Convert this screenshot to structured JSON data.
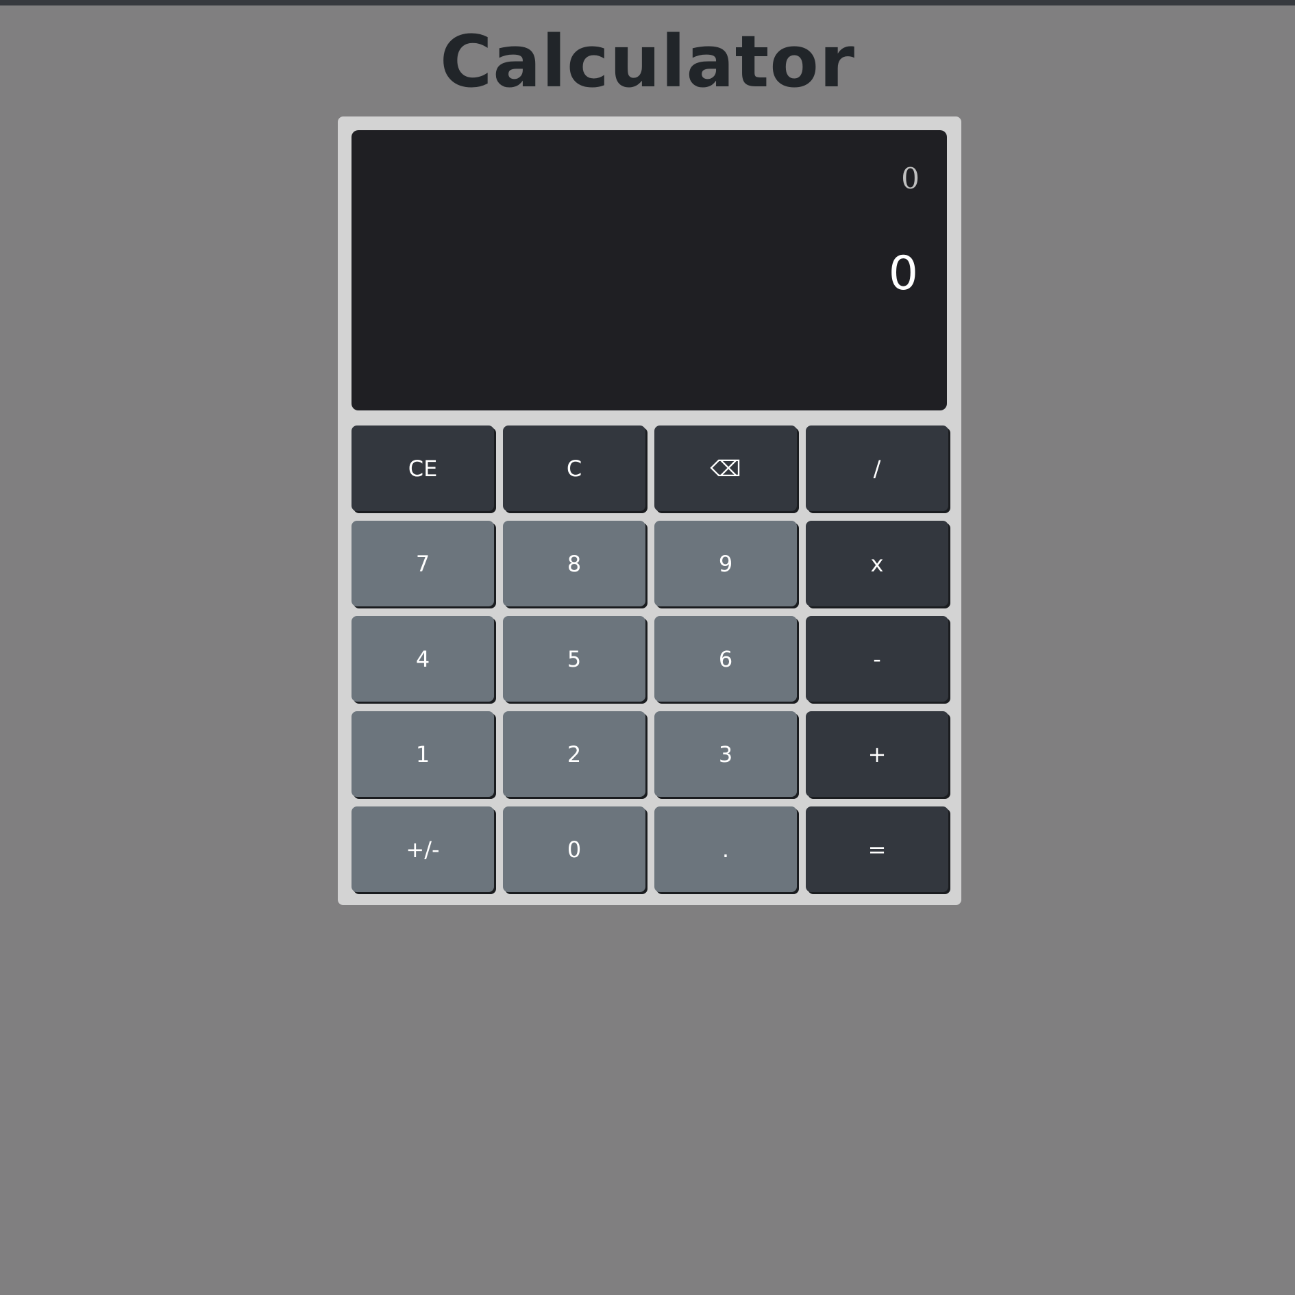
{
  "title": "Calculator",
  "display": {
    "previous": "0",
    "current": "0"
  },
  "keys": [
    {
      "label": "CE",
      "style": "dark",
      "name": "clear-entry-button"
    },
    {
      "label": "C",
      "style": "dark",
      "name": "clear-button"
    },
    {
      "label": "⌫",
      "style": "dark",
      "name": "backspace-button"
    },
    {
      "label": "/",
      "style": "dark",
      "name": "divide-button"
    },
    {
      "label": "7",
      "style": "light",
      "name": "digit-7-button"
    },
    {
      "label": "8",
      "style": "light",
      "name": "digit-8-button"
    },
    {
      "label": "9",
      "style": "light",
      "name": "digit-9-button"
    },
    {
      "label": "x",
      "style": "dark",
      "name": "multiply-button"
    },
    {
      "label": "4",
      "style": "light",
      "name": "digit-4-button"
    },
    {
      "label": "5",
      "style": "light",
      "name": "digit-5-button"
    },
    {
      "label": "6",
      "style": "light",
      "name": "digit-6-button"
    },
    {
      "label": "-",
      "style": "dark",
      "name": "subtract-button"
    },
    {
      "label": "1",
      "style": "light",
      "name": "digit-1-button"
    },
    {
      "label": "2",
      "style": "light",
      "name": "digit-2-button"
    },
    {
      "label": "3",
      "style": "light",
      "name": "digit-3-button"
    },
    {
      "label": "+",
      "style": "dark",
      "name": "add-button"
    },
    {
      "label": "+/-",
      "style": "light",
      "name": "negate-button"
    },
    {
      "label": "0",
      "style": "light",
      "name": "digit-0-button"
    },
    {
      "label": ".",
      "style": "light",
      "name": "decimal-button"
    },
    {
      "label": "=",
      "style": "dark",
      "name": "equals-button"
    }
  ],
  "colors": {
    "page_background": "#807f80",
    "frame": "#d3d3d3",
    "display_background": "#1f1f23",
    "operator_key": "#33373e",
    "digit_key": "#6c757d",
    "title_text": "#212529"
  }
}
